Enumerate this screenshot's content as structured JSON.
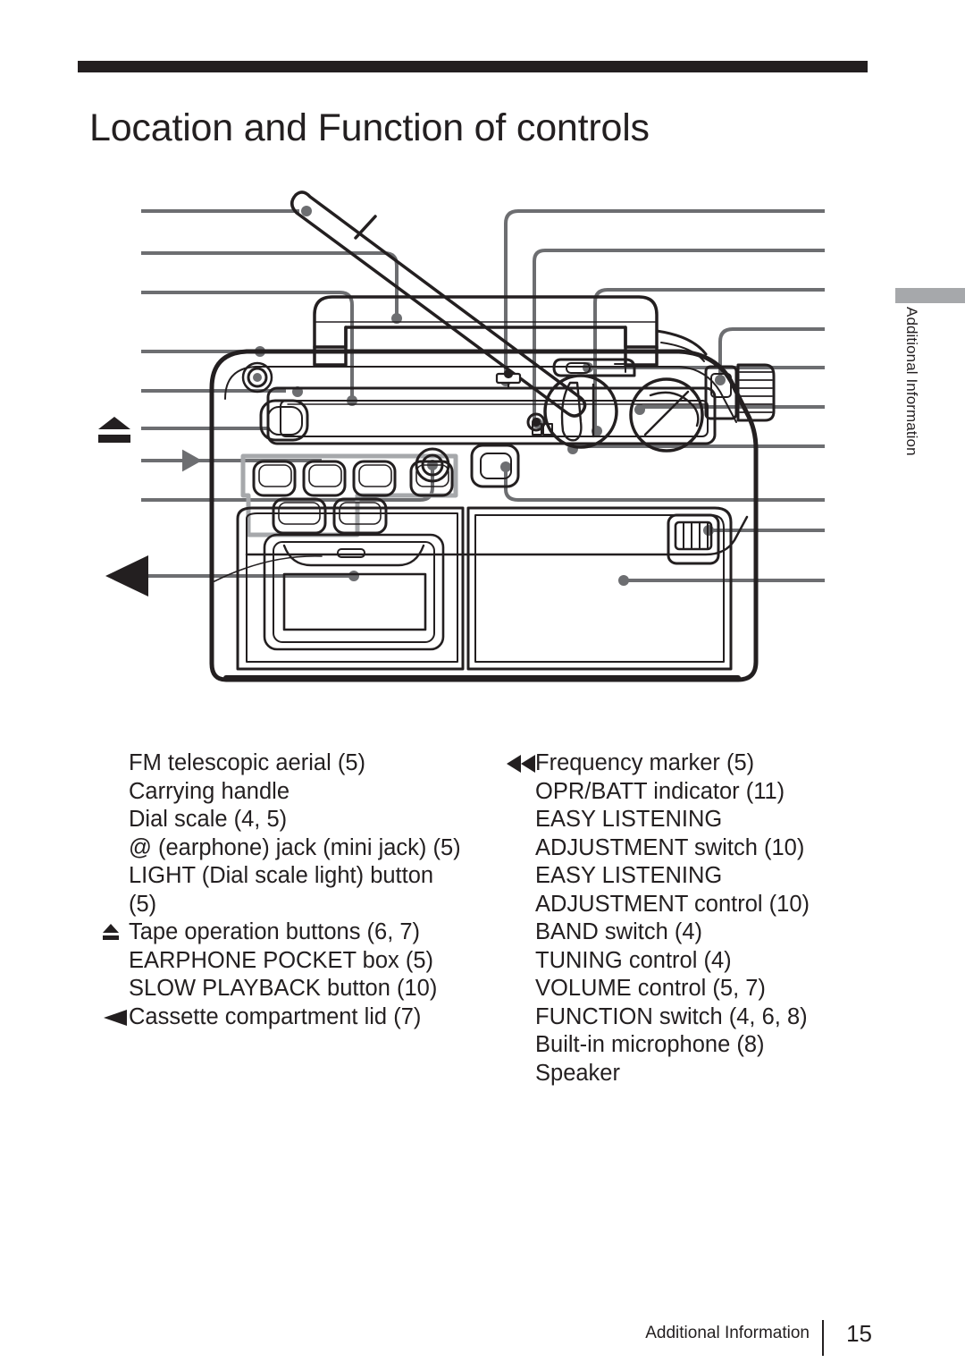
{
  "header": {
    "title": "Location and Function of controls"
  },
  "side_tab": {
    "label": "Additional Information"
  },
  "captions": {
    "left_column": [
      {
        "marker": "none",
        "text": "FM telescopic aerial (5)"
      },
      {
        "marker": "none",
        "text": "Carrying handle"
      },
      {
        "marker": "none",
        "text": "Dial scale (4, 5)"
      },
      {
        "marker": "none",
        "text": "@ (earphone) jack (mini jack) (5)"
      },
      {
        "marker": "none",
        "text": "LIGHT (Dial scale light) button"
      },
      {
        "marker": "none",
        "text": "(5)"
      },
      {
        "marker": "eject-icon",
        "text": "Tape operation buttons (6, 7)"
      },
      {
        "marker": "none",
        "text": "EARPHONE POCKET box (5)"
      },
      {
        "marker": "none",
        "text": "SLOW PLAYBACK button (10)"
      },
      {
        "marker": "triangle-left",
        "text": "Cassette compartment lid (7)"
      }
    ],
    "right_column": [
      {
        "marker": "double-triangle-left",
        "text": "Frequency marker (5)"
      },
      {
        "marker": "none",
        "text": "OPR/BATT indicator (11)"
      },
      {
        "marker": "none",
        "text": "EASY LISTENING"
      },
      {
        "marker": "none",
        "text": "ADJUSTMENT switch (10)"
      },
      {
        "marker": "none",
        "text": "EASY LISTENING"
      },
      {
        "marker": "none",
        "text": "ADJUSTMENT control (10)"
      },
      {
        "marker": "none",
        "text": "BAND switch (4)"
      },
      {
        "marker": "none",
        "text": "TUNING control (4)"
      },
      {
        "marker": "none",
        "text": "VOLUME control (5, 7)"
      },
      {
        "marker": "none",
        "text": "FUNCTION switch (4, 6, 8)"
      },
      {
        "marker": "none",
        "text": "Built-in microphone (8)"
      },
      {
        "marker": "none",
        "text": "Speaker"
      }
    ]
  },
  "footer": {
    "section": "Additional Information",
    "page_number": "15"
  },
  "colors": {
    "ink": "#231f20",
    "leader": "#6d6e71",
    "tab_bar": "#a6a8ab",
    "paper": "#ffffff"
  }
}
